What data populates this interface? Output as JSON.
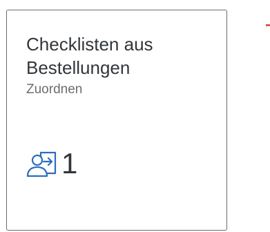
{
  "tile": {
    "title": "Checklisten aus Bestellungen",
    "subtitle": "Zuordnen",
    "kpi_value": "1",
    "icon": "assign-person-icon",
    "accent_color": "#2a6dbd",
    "text_color": "#32363a",
    "subtitle_color": "#6a6d70"
  },
  "corner_mark": {
    "color": "#e2574c"
  }
}
